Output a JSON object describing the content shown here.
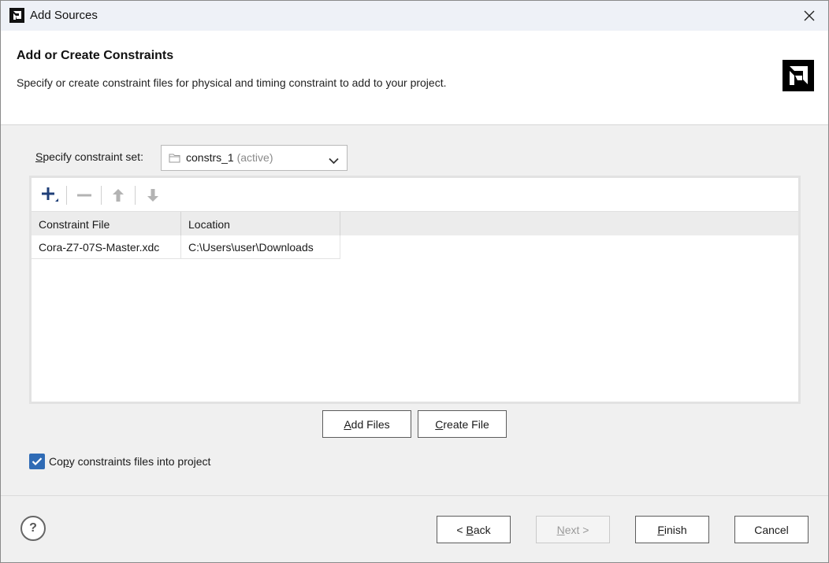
{
  "window": {
    "title": "Add Sources",
    "close_icon": "close-icon"
  },
  "header": {
    "title": "Add or Create Constraints",
    "description": "Specify or create constraint files for physical and timing constraint to add to your project."
  },
  "constraint_set": {
    "label_mnemonic": "S",
    "label_rest": "pecify constraint set:",
    "value": "constrs_1",
    "status": "(active)"
  },
  "toolbar": {
    "add_icon": "plus-icon",
    "remove_icon": "minus-icon",
    "up_icon": "arrow-up-icon",
    "down_icon": "arrow-down-icon"
  },
  "table": {
    "columns": [
      "Constraint File",
      "Location"
    ],
    "rows": [
      [
        "Cora-Z7-07S-Master.xdc",
        "C:\\Users\\user\\Downloads"
      ]
    ]
  },
  "buttons": {
    "add_files": {
      "mnemonic": "A",
      "rest": "dd Files"
    },
    "create_file": {
      "mnemonic": "C",
      "rest": "reate File"
    },
    "back": {
      "prefix": "< ",
      "mnemonic": "B",
      "rest": "ack"
    },
    "next": {
      "mnemonic": "N",
      "rest": "ext >"
    },
    "finish": {
      "mnemonic": "F",
      "rest": "inish"
    },
    "cancel": "Cancel"
  },
  "copy_checkbox": {
    "checked": true,
    "label_pre": "Co",
    "label_mnemonic": "p",
    "label_post": "y constraints files into project"
  },
  "help": {
    "label": "?"
  },
  "colors": {
    "accent": "#2f6bb5",
    "toolbar_icon": "#2a4f8a"
  }
}
